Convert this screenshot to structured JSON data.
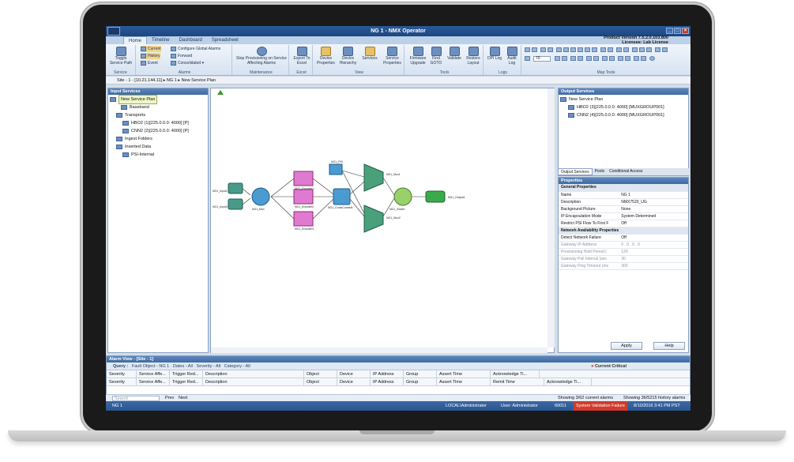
{
  "window": {
    "title": "NG 1 - NMX Operator",
    "product_version": "Product Version 7.5.2.0.103.800",
    "license": "Licensee: Lab License"
  },
  "tabs": [
    "Home",
    "Timeline",
    "Dashboard",
    "Spreadsheet"
  ],
  "ribbon": {
    "service": {
      "toggle": "Toggle Service Path",
      "label": "Service"
    },
    "alarms": {
      "current": "Current",
      "history": "History",
      "event": "Event",
      "configure": "Configure Global Alarms",
      "forward": "Forward",
      "consolidated": "Consolidated",
      "label": "Alarms"
    },
    "maintenance": {
      "stop": "Stop Provisioning on Service Affecting Alarms",
      "label": "Maintenance"
    },
    "excel": {
      "export": "Export To Excel",
      "label": "Excel"
    },
    "view": {
      "device_props": "Device Properties",
      "device_hier": "Device Hierarchy",
      "services": "Services",
      "service_props": "Service Properties",
      "label": "View"
    },
    "tools": {
      "firmware": "Firmware Upgrade",
      "find": "Find GOTO",
      "validate": "Validate",
      "restore": "Restore Layout",
      "label": "Tools"
    },
    "logs": {
      "dpi": "DPI Log",
      "audit": "Audit Log",
      "label": "Logs"
    },
    "maptools": {
      "zoom": "70",
      "label": "Map Tools"
    }
  },
  "breadcrumb": [
    "Site - 1 - [10.21.144.11]",
    "NG 1",
    "New Service Plan"
  ],
  "input_services": {
    "title": "Input Services",
    "items": [
      "New Service Plan",
      "Baseband",
      "Transports",
      "HBO2 (1)[225.0.0.0: 4000] [P]",
      "CNN2 (2)[225.0.0.0: 4000] [P]",
      "Ingest Folders",
      "Inserted Data",
      "PSI-Internal"
    ]
  },
  "canvas": {
    "nodes": [
      "NG1_Input1",
      "NG1_Input3",
      "NG1_Mux",
      "NG1_Encoder1",
      "NG1_Encoder2",
      "NG1_Encoder3",
      "NG1_CrossConnect",
      "NG1_PSI",
      "NG1_Mux1",
      "NG1_Mux2",
      "NG1_Switch",
      "NG1_Output1"
    ]
  },
  "output_services": {
    "title": "Output Services",
    "items": [
      "New Service Plan",
      "HBO2 (3)[225.0.0.0: 4000] [MUXGROUP001]",
      "CNN2 (4)[225.0.0.0: 4000] [MUXGROUP001]"
    ],
    "tabs": [
      "Output Services",
      "Pools",
      "Conditional Access"
    ]
  },
  "properties": {
    "title": "Properties",
    "rows": [
      {
        "k": "General Properties",
        "v": "",
        "sec": true
      },
      {
        "k": "Name",
        "v": "NG 1"
      },
      {
        "k": "Description",
        "v": "NMX7520_UG"
      },
      {
        "k": "Background Picture",
        "v": "None"
      },
      {
        "k": "IP Encapsulation Mode",
        "v": "System Determined"
      },
      {
        "k": "Restrict PSI Flow To First F",
        "v": "Off"
      },
      {
        "k": "Network Availability Properties",
        "v": "",
        "sec": true
      },
      {
        "k": "Detect Network Failure",
        "v": "Off"
      },
      {
        "k": "Gateway IP Address",
        "v": "0 . 0 . 0 . 0",
        "dim": true
      },
      {
        "k": "Provisioning Hold Period (",
        "v": "120",
        "dim": true
      },
      {
        "k": "Gateway Poll Interval (sec",
        "v": "30",
        "dim": true
      },
      {
        "k": "Gateway Ping Timeout (ms",
        "v": "300",
        "dim": true
      }
    ],
    "apply": "Apply",
    "help": "Help"
  },
  "alarm_view": {
    "title": "Alarm View - [Site - 1]",
    "query": "Query :",
    "filters": [
      "Fault Object - NG 1",
      "Dates - All",
      "Severity - All",
      "Category - All"
    ],
    "current_critical": "Current Critical",
    "cols1": [
      "Severity",
      "Service Affe...",
      "Trigger Red...",
      "Description",
      "Object",
      "Device",
      "IP Address",
      "Group",
      "Assert Time",
      "Acknowledge Ti..."
    ],
    "cols2": [
      "Severity",
      "Service Affe...",
      "Trigger Red...",
      "Description",
      "Object",
      "Device",
      "IP Address",
      "Group",
      "Assert Time",
      "Remit Time",
      "Acknowledge Ti..."
    ],
    "search": "Search",
    "prev": "Prev",
    "next": "Next",
    "showing_current": "Showing 3/62 current alarms",
    "showing_history": "Showing 36/5215 history alarms"
  },
  "status": {
    "ng": "NG 1",
    "user1": "LOCAL\\Administrator",
    "user2": "User: Administrator",
    "port": "60011",
    "validation": "System Validation Failure",
    "time": "8/10/2016 3:41 PM PST"
  }
}
